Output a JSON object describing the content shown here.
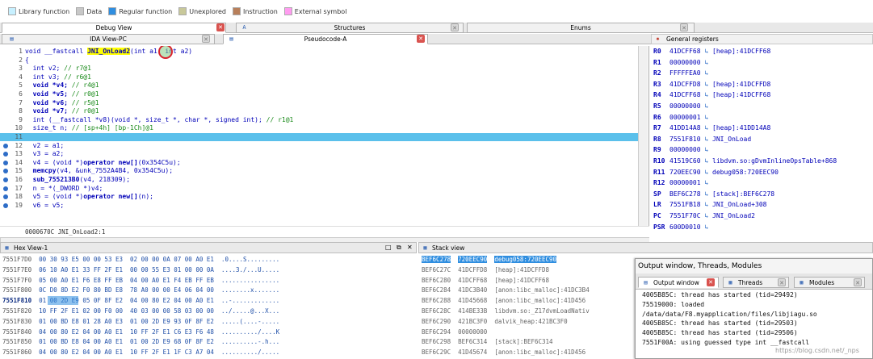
{
  "legend": [
    {
      "label": "Library function",
      "color": "#c7f0ff"
    },
    {
      "label": "Data",
      "color": "#c8c8c8"
    },
    {
      "label": "Regular function",
      "color": "#2f8ee0"
    },
    {
      "label": "Unexplored",
      "color": "#c8c89a"
    },
    {
      "label": "Instruction",
      "color": "#b87f5a"
    },
    {
      "label": "External symbol",
      "color": "#ff9cf0"
    }
  ],
  "tabs_top": {
    "debug_view": "Debug View",
    "structures": "Structures",
    "enums": "Enums"
  },
  "tabs_second": {
    "ida_view": "IDA View-PC",
    "pseudocode": "Pseudocode-A"
  },
  "registers_title": "General registers",
  "code_lines": [
    {
      "n": "1",
      "parts": [
        [
          "t",
          "void __fastcall "
        ],
        [
          "hl",
          "JNI_OnLoad2"
        ],
        [
          "t",
          "("
        ],
        [
          "t",
          "int a1, int a2)"
        ]
      ]
    },
    {
      "n": "2",
      "parts": [
        [
          "t",
          "{"
        ]
      ]
    },
    {
      "n": "3",
      "parts": [
        [
          "t",
          "  int v2; "
        ],
        [
          "c",
          "// r7@1"
        ]
      ]
    },
    {
      "n": "4",
      "parts": [
        [
          "t",
          "  int v3; "
        ],
        [
          "c",
          "// r6@1"
        ]
      ]
    },
    {
      "n": "5",
      "parts": [
        [
          "k",
          "  void *v4; "
        ],
        [
          "c",
          "// r4@1"
        ]
      ]
    },
    {
      "n": "6",
      "parts": [
        [
          "k",
          "  void *v5; "
        ],
        [
          "c",
          "// r0@1"
        ]
      ]
    },
    {
      "n": "7",
      "parts": [
        [
          "k",
          "  void *v6; "
        ],
        [
          "c",
          "// r5@1"
        ]
      ]
    },
    {
      "n": "8",
      "parts": [
        [
          "k",
          "  void *v7; "
        ],
        [
          "c",
          "// r0@1"
        ]
      ]
    },
    {
      "n": "9",
      "parts": [
        [
          "t",
          "  int (__fastcall *v8)(void *, size_t *, char *, signed int); "
        ],
        [
          "c",
          "// r1@1"
        ]
      ]
    },
    {
      "n": "10",
      "parts": [
        [
          "t",
          "  size_t n; "
        ],
        [
          "c",
          "// [sp+4h] [bp-1Ch]@1"
        ]
      ]
    },
    {
      "n": "11",
      "parts": [
        [
          "t",
          ""
        ]
      ]
    },
    {
      "n": "12",
      "parts": [
        [
          "t",
          "  v2 = a1;"
        ]
      ]
    },
    {
      "n": "13",
      "parts": [
        [
          "t",
          "  v3 = a2;"
        ]
      ]
    },
    {
      "n": "14",
      "parts": [
        [
          "t",
          "  v4 = (void *)"
        ],
        [
          "k",
          "operator new[]"
        ],
        [
          "t",
          "(0x354C5u);"
        ]
      ]
    },
    {
      "n": "15",
      "parts": [
        [
          "k",
          "  memcpy"
        ],
        [
          "t",
          "(v4, &unk_7552A4B4, 0x354C5u);"
        ]
      ]
    },
    {
      "n": "16",
      "parts": [
        [
          "k",
          "  sub_755213B0"
        ],
        [
          "t",
          "(v4, 218309);"
        ]
      ]
    },
    {
      "n": "17",
      "parts": [
        [
          "t",
          "  n = *(_DWORD *)v4;"
        ]
      ]
    },
    {
      "n": "18",
      "parts": [
        [
          "t",
          "  v5 = (void *)"
        ],
        [
          "k",
          "operator new[]"
        ],
        [
          "t",
          "(n);"
        ]
      ]
    },
    {
      "n": "19",
      "parts": [
        [
          "t",
          "  v6 = v5;"
        ]
      ]
    }
  ],
  "code_status": "0000670C JNI_OnLoad2:1",
  "registers": [
    {
      "name": "R0",
      "value": "41DCFF68",
      "ref": "[heap]:41DCFF68"
    },
    {
      "name": "R1",
      "value": "00000000",
      "ref": ""
    },
    {
      "name": "R2",
      "value": "FFFFFEA0",
      "ref": ""
    },
    {
      "name": "R3",
      "value": "41DCFFD8",
      "ref": "[heap]:41DCFFD8"
    },
    {
      "name": "R4",
      "value": "41DCFF68",
      "ref": "[heap]:41DCFF68"
    },
    {
      "name": "R5",
      "value": "00000000",
      "ref": ""
    },
    {
      "name": "R6",
      "value": "00000001",
      "ref": ""
    },
    {
      "name": "R7",
      "value": "41DD14A8",
      "ref": "[heap]:41DD14A8"
    },
    {
      "name": "R8",
      "value": "7551F810",
      "ref": "JNI_OnLoad"
    },
    {
      "name": "R9",
      "value": "00000000",
      "ref": ""
    },
    {
      "name": "R10",
      "value": "41519C60",
      "ref": "libdvm.so:gDvmInlineOpsTable+868"
    },
    {
      "name": "R11",
      "value": "720EEC90",
      "ref": "debug058:720EEC90"
    },
    {
      "name": "R12",
      "value": "00000001",
      "ref": ""
    },
    {
      "name": "SP",
      "value": "BEF6C278",
      "ref": "[stack]:BEF6C278"
    },
    {
      "name": "LR",
      "value": "7551FB18",
      "ref": "JNI_OnLoad+308"
    },
    {
      "name": "PC",
      "value": "7551F70C",
      "ref": "JNI_OnLoad2"
    },
    {
      "name": "PSR",
      "value": "600D0010",
      "ref": ""
    }
  ],
  "hex_title": "Hex View-1",
  "hex_rows": [
    {
      "addr": "7551F7D0",
      "bytes": "00 30 93 E5 00 00 53 E3  02 00 00 0A 07 00 A0 E1",
      "ascii": ".0....S........."
    },
    {
      "addr": "7551F7E0",
      "bytes": "06 10 A0 E1 33 FF 2F E1  00 00 55 E3 01 00 00 0A",
      "ascii": "....3./...U....."
    },
    {
      "addr": "7551F7F0",
      "bytes": "05 00 A0 E1 F6 E8 FF EB  04 00 A0 E1 F4 EB FF EB",
      "ascii": "................"
    },
    {
      "addr": "7551F800",
      "bytes": "0C D0 8D E2 F0 80 BD E8  78 A0 00 00 E4 06 04 00",
      "ascii": "........x......."
    },
    {
      "addr": "7551F810",
      "bytes": "01 00 2D E9 05 0F 8F E2  04 00 80 E2 04 00 A0 E1",
      "ascii": "..-............."
    },
    {
      "addr": "7551F820",
      "bytes": "10 FF 2F E1 02 00 F0 00  40 03 00 00 58 03 00 00",
      "ascii": "../.....@...X..."
    },
    {
      "addr": "7551F830",
      "bytes": "01 00 BD E8 01 28 A0 E3  01 00 2D E9 93 0F 8F E2",
      "ascii": ".....(....-....."
    },
    {
      "addr": "7551F840",
      "bytes": "04 00 80 E2 04 00 A0 E1  10 FF 2F E1 C6 E3 F6 48",
      "ascii": "........../....K"
    },
    {
      "addr": "7551F850",
      "bytes": "01 00 BD E8 04 00 A0 E1  01 00 2D E9 68 0F 8F E2",
      "ascii": "..........-.h..."
    },
    {
      "addr": "7551F860",
      "bytes": "04 00 80 E2 04 00 A0 E1  10 FF 2F E1 1F C3 A7 04",
      "ascii": "........../....."
    }
  ],
  "stack_title": "Stack view",
  "stack_rows": [
    {
      "addr": "BEF6C278",
      "value": "720EEC90",
      "desc": "debug058:720EEC90"
    },
    {
      "addr": "BEF6C27C",
      "value": "41DCFFD8",
      "desc": "[heap]:41DCFFD8"
    },
    {
      "addr": "BEF6C280",
      "value": "41DCFF68",
      "desc": "[heap]:41DCFF68"
    },
    {
      "addr": "BEF6C284",
      "value": "41DC3B40",
      "desc": "[anon:libc_malloc]:41DC3B4"
    },
    {
      "addr": "BEF6C288",
      "value": "41D45668",
      "desc": "[anon:libc_malloc]:41D456"
    },
    {
      "addr": "BEF6C28C",
      "value": "414BE33B",
      "desc": "libdvm.so:_Z17dvmLoadNativ"
    },
    {
      "addr": "BEF6C290",
      "value": "421BC3F0",
      "desc": "dalvik_heap:421BC3F0"
    },
    {
      "addr": "BEF6C294",
      "value": "00000000",
      "desc": ""
    },
    {
      "addr": "BEF6C298",
      "value": "BEF6C314",
      "desc": "[stack]:BEF6C314"
    },
    {
      "addr": "BEF6C29C",
      "value": "41D45674",
      "desc": "[anon:libc_malloc]:41D456"
    }
  ],
  "output": {
    "title": "Output window, Threads, Modules",
    "tabs": [
      "Output window",
      "Threads",
      "Modules"
    ],
    "lines": [
      "4005B85C: thread has started (tid=29492)",
      "75519000: loaded",
      "/data/data/F8.myapplication/files/libjiagu.so",
      "4005B85C: thread has started (tid=29503)",
      "4005B85C: thread has started (tid=29506)",
      "7551F00A: using guessed type int __fastcall"
    ]
  },
  "watermark": "https://blog.csdn.net/_nps"
}
